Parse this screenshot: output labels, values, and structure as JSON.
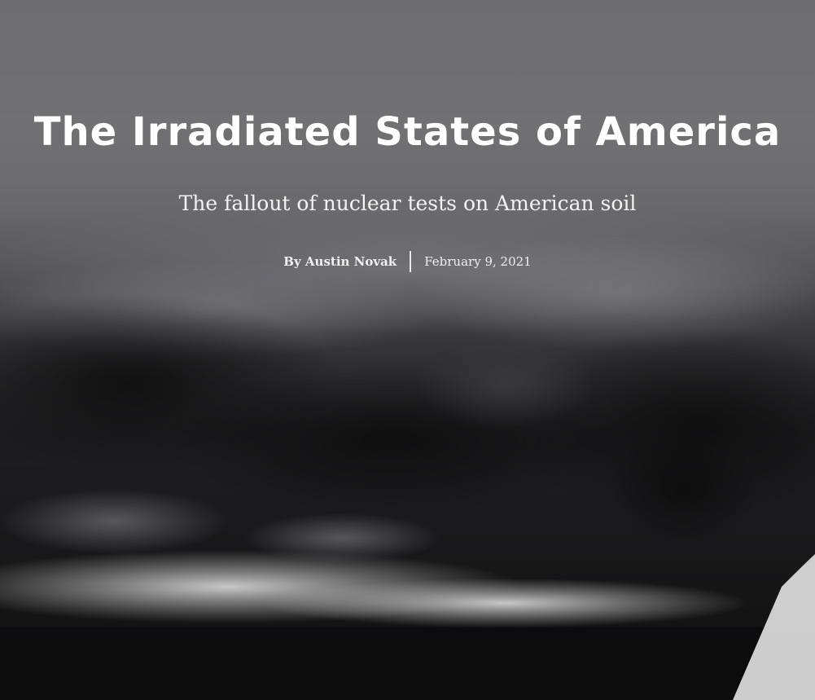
{
  "article": {
    "title": "The Irradiated States of America",
    "subtitle": "The fallout of nuclear tests on American soil",
    "byline": "By Austin Novak",
    "date": "February 9, 2021"
  },
  "colors": {
    "text": "#ffffff",
    "background_top": "#6d6d6f",
    "background_bottom": "#0e0e0f"
  },
  "hero_image": {
    "description_icon": "nuclear-test-smoke-photo"
  }
}
